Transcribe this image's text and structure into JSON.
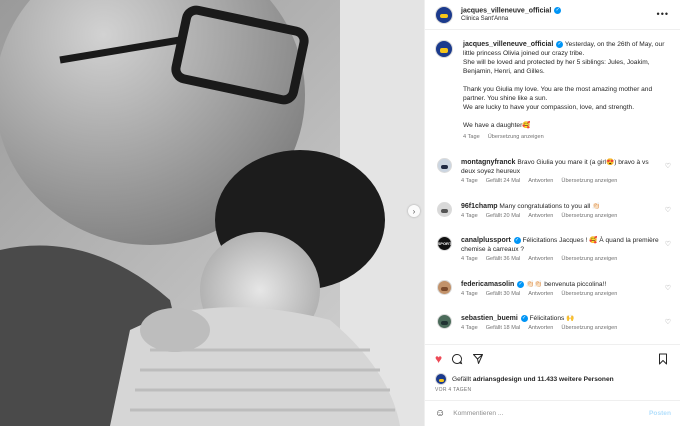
{
  "post": {
    "author": "jacques_villeneuve_official",
    "location": "Clinica Sant'Anna",
    "caption_lines": [
      "Yesterday, on the 26th of May, our little princess Olivia joined our crazy tribe.",
      "She will be loved and protected by her 5 siblings: Jules, Joakim, Benjamin, Henri, and Gilles."
    ],
    "caption_para2": "Thank you Giulia my love. You are the most amazing mother and partner. You shine like a sun.",
    "caption_para3": "We are lucky to have your compassion, love, and strength.",
    "caption_para4": "We have a daughter🥰",
    "caption_age": "4 Tage",
    "translate_label": "Übersetzung anzeigen"
  },
  "comments": [
    {
      "user": "montagnyfranck",
      "verified": false,
      "text": "Bravo Giulia you mare it (a girl😍) bravo à vs deux soyez heureux",
      "age": "4 Tage",
      "likes": "Gefällt 24 Mal",
      "reply": "Antworten",
      "translate": "Übersetzung anzeigen"
    },
    {
      "user": "96f1champ",
      "verified": false,
      "text": "Many congratulations to you all 👏🏻",
      "age": "4 Tage",
      "likes": "Gefällt 20 Mal",
      "reply": "Antworten",
      "translate": "Übersetzung anzeigen"
    },
    {
      "user": "canalplussport",
      "verified": true,
      "text": "Félicitations Jacques ! 🥰 À quand la première chemise à carreaux ?",
      "age": "4 Tage",
      "likes": "Gefällt 36 Mal",
      "reply": "Antworten",
      "translate": "Übersetzung anzeigen",
      "avatar_text": "SPORT"
    },
    {
      "user": "federicamasolin",
      "verified": true,
      "text": "👏🏻👏🏻 benvenuta piccolina!!",
      "age": "4 Tage",
      "likes": "Gefällt 30 Mal",
      "reply": "Antworten",
      "translate": "Übersetzung anzeigen"
    },
    {
      "user": "sebastien_buemi",
      "verified": true,
      "text": "Félicitations 🙌",
      "age": "4 Tage",
      "likes": "Gefällt 18 Mal",
      "reply": "Antworten",
      "translate": "Übersetzung anzeigen"
    }
  ],
  "likes": {
    "prefix": "Gefällt",
    "user": "adriansgdesign",
    "suffix": "und 11.433 weitere Personen"
  },
  "date": "VOR 4 TAGEN",
  "composer": {
    "placeholder": "Kommentieren ...",
    "post_label": "Posten"
  },
  "icons": {
    "more": "more-dots-icon",
    "heart": "heart-icon",
    "comment": "comment-icon",
    "share": "share-icon",
    "save": "bookmark-icon",
    "emoji": "emoji-icon",
    "next": "chevron-right-icon",
    "verified": "verified-badge-icon"
  },
  "colors": {
    "accent": "#0095f6",
    "liked_heart": "#ed4956",
    "mention": "#00376b",
    "muted": "#737373"
  }
}
